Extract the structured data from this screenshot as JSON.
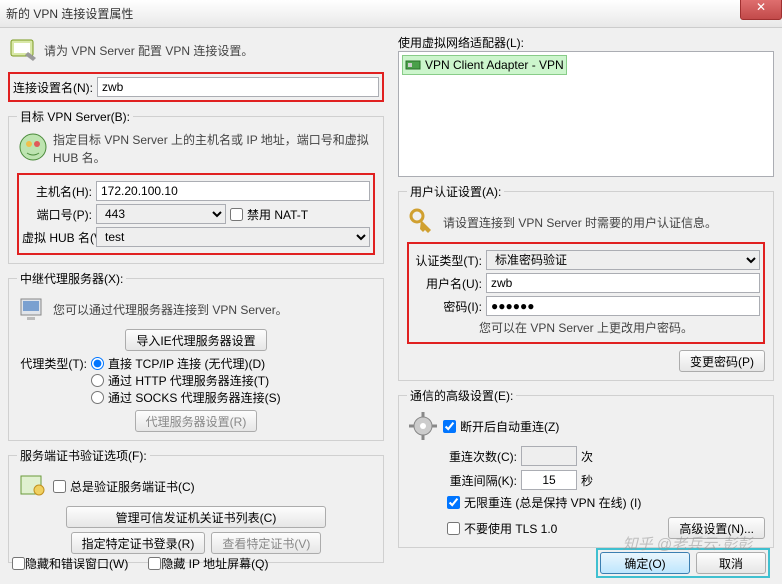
{
  "title": "新的 VPN 连接设置属性",
  "left": {
    "intro": "请为 VPN Server 配置 VPN 连接设置。",
    "conn_name_label": "连接设置名(N):",
    "conn_name_value": "zwb",
    "target_server": {
      "legend": "目标 VPN Server(B):",
      "desc": "指定目标 VPN Server 上的主机名或 IP 地址，端口号和虚拟 HUB 名。",
      "host_label": "主机名(H):",
      "host_value": "172.20.100.10",
      "port_label": "端口号(P):",
      "port_value": "443",
      "natt_label": "禁用 NAT-T",
      "hub_label": "虚拟 HUB 名(V):",
      "hub_value": "test"
    },
    "proxy": {
      "legend": "中继代理服务器(X):",
      "desc": "您可以通过代理服务器连接到 VPN Server。",
      "import_btn": "导入IE代理服务器设置",
      "type_label": "代理类型(T):",
      "opt_direct": "直接 TCP/IP 连接 (无代理)(D)",
      "opt_http": "通过 HTTP 代理服务器连接(T)",
      "opt_socks": "通过 SOCKS 代理服务器连接(S)",
      "settings_btn": "代理服务器设置(R)"
    },
    "cert": {
      "legend": "服务端证书验证选项(F):",
      "always_label": "总是验证服务端证书(C)",
      "ca_btn": "管理可信发证机关证书列表(C)",
      "reg_btn": "指定特定证书登录(R)",
      "view_btn": "查看特定证书(V)"
    }
  },
  "right": {
    "adapter": {
      "label": "使用虚拟网络适配器(L):",
      "item": "VPN Client Adapter - VPN"
    },
    "auth": {
      "legend": "用户认证设置(A):",
      "desc": "请设置连接到 VPN Server 时需要的用户认证信息。",
      "type_label": "认证类型(T):",
      "type_value": "标准密码验证",
      "user_label": "用户名(U):",
      "user_value": "zwb",
      "pass_label": "密码(I):",
      "pass_value": "●●●●●●",
      "note": "您可以在 VPN Server 上更改用户密码。",
      "change_btn": "变更密码(P)"
    },
    "adv": {
      "legend": "通信的高级设置(E):",
      "redial_label": "断开后自动重连(Z)",
      "count_label": "重连次数(C):",
      "count_value": "",
      "count_unit": "次",
      "interval_label": "重连间隔(K):",
      "interval_value": "15",
      "interval_unit": "秒",
      "infinite_label": "无限重连 (总是保持 VPN 在线) (I)",
      "tls_label": "不要使用 TLS 1.0",
      "adv_btn": "高级设置(N)..."
    }
  },
  "footer": {
    "hide_err": "隐藏和错误窗口(W)",
    "hide_ip": "隐藏 IP 地址屏幕(Q)",
    "ok": "确定(O)",
    "cancel": "取消"
  },
  "watermark": "知乎 @老兵云·彭彭"
}
